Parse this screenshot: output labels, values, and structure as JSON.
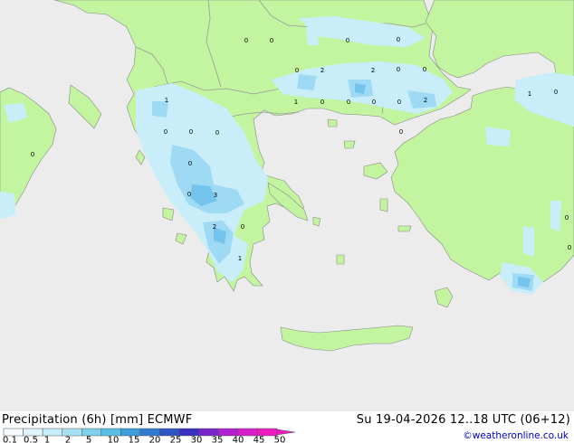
{
  "footer": {
    "title": "Precipitation (6h) [mm] ECMWF",
    "valid_time": "Su 19-04-2026 12..18 UTC (06+12)",
    "credit": "©weatheronline.co.uk"
  },
  "legend": {
    "labels": [
      "0.1",
      "0.5",
      "1",
      "2",
      "5",
      "10",
      "15",
      "20",
      "25",
      "30",
      "35",
      "40",
      "45",
      "50"
    ],
    "colors": [
      "#f5fbff",
      "#e0f4fb",
      "#c6eef8",
      "#a6e2f4",
      "#7fd2ee",
      "#58bfe7",
      "#3c9fdc",
      "#2f7ad0",
      "#2b55c5",
      "#3a2fc0",
      "#7a25c8",
      "#b01fd0",
      "#d81ec8",
      "#ee1ac0"
    ]
  },
  "map": {
    "colors": {
      "sea": "#ececec",
      "land": "#c3f4a0",
      "border": "#999999",
      "coast": "#888888",
      "precip_light": "#c9eefa",
      "precip_medium": "#9fdaf4",
      "precip_heavy": "#74c4ee"
    },
    "labels": [
      {
        "text": "0"
      },
      {
        "text": "0"
      },
      {
        "text": "0"
      },
      {
        "text": "0"
      },
      {
        "text": "0"
      },
      {
        "text": "2"
      },
      {
        "text": "2"
      },
      {
        "text": "0"
      },
      {
        "text": "0"
      },
      {
        "text": "1"
      },
      {
        "text": "0"
      },
      {
        "text": "0"
      },
      {
        "text": "0"
      },
      {
        "text": "0"
      },
      {
        "text": "2"
      },
      {
        "text": "1"
      },
      {
        "text": "0"
      },
      {
        "text": "0"
      },
      {
        "text": "0"
      },
      {
        "text": "0"
      },
      {
        "text": "0"
      },
      {
        "text": "0"
      },
      {
        "text": "3"
      },
      {
        "text": "2"
      },
      {
        "text": "0"
      },
      {
        "text": "1"
      },
      {
        "text": "1"
      },
      {
        "text": "0"
      },
      {
        "text": "0"
      },
      {
        "text": "0"
      },
      {
        "text": "0"
      }
    ]
  }
}
